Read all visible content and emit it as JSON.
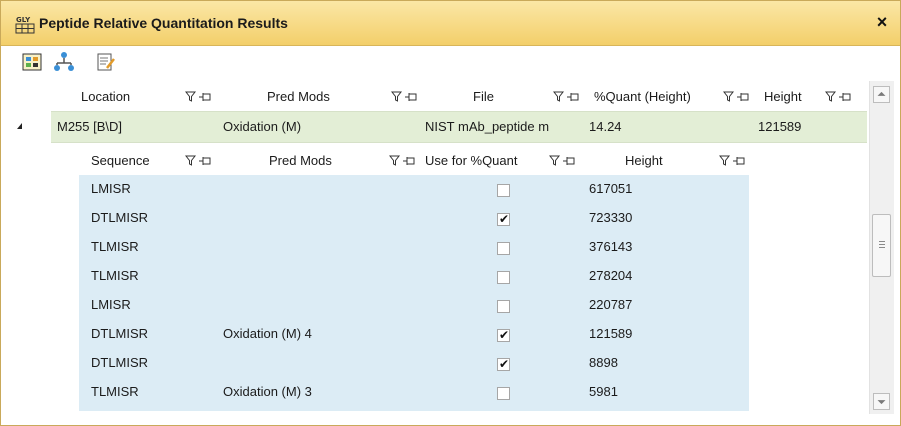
{
  "window": {
    "title": "Peptide Relative Quantitation Results",
    "close_label": "×",
    "app_icon": "glyco-app-icon"
  },
  "toolbar": {
    "icons": [
      "settings-grid-icon",
      "share-network-icon",
      "notes-edit-icon"
    ]
  },
  "outer_table": {
    "headers": [
      "Location",
      "Pred Mods",
      "File",
      "%Quant (Height)",
      "Height"
    ],
    "row": {
      "location": "M255 [B\\D]",
      "pred_mods": "Oxidation (M)",
      "file": "NIST mAb_peptide m",
      "quant": "14.24",
      "height": "121589"
    }
  },
  "inner_table": {
    "headers": [
      "Sequence",
      "Pred Mods",
      "Use for %Quant",
      "Height"
    ],
    "rows": [
      {
        "sequence": "LMISR",
        "pred_mods": "",
        "checked": false,
        "height": "617051"
      },
      {
        "sequence": "DTLMISR",
        "pred_mods": "",
        "checked": true,
        "height": "723330"
      },
      {
        "sequence": "TLMISR",
        "pred_mods": "",
        "checked": false,
        "height": "376143"
      },
      {
        "sequence": "TLMISR",
        "pred_mods": "",
        "checked": false,
        "height": "278204"
      },
      {
        "sequence": "LMISR",
        "pred_mods": "",
        "checked": false,
        "height": "220787"
      },
      {
        "sequence": "DTLMISR",
        "pred_mods": "Oxidation (M) 4",
        "checked": true,
        "height": "121589"
      },
      {
        "sequence": "DTLMISR",
        "pred_mods": "",
        "checked": true,
        "height": "8898"
      },
      {
        "sequence": "TLMISR",
        "pred_mods": "Oxidation (M) 3",
        "checked": false,
        "height": "5981"
      }
    ]
  },
  "colors": {
    "titlebar": "#f3cf6a",
    "outer_row": "#e3eed6",
    "inner_body": "#dcecf5"
  }
}
